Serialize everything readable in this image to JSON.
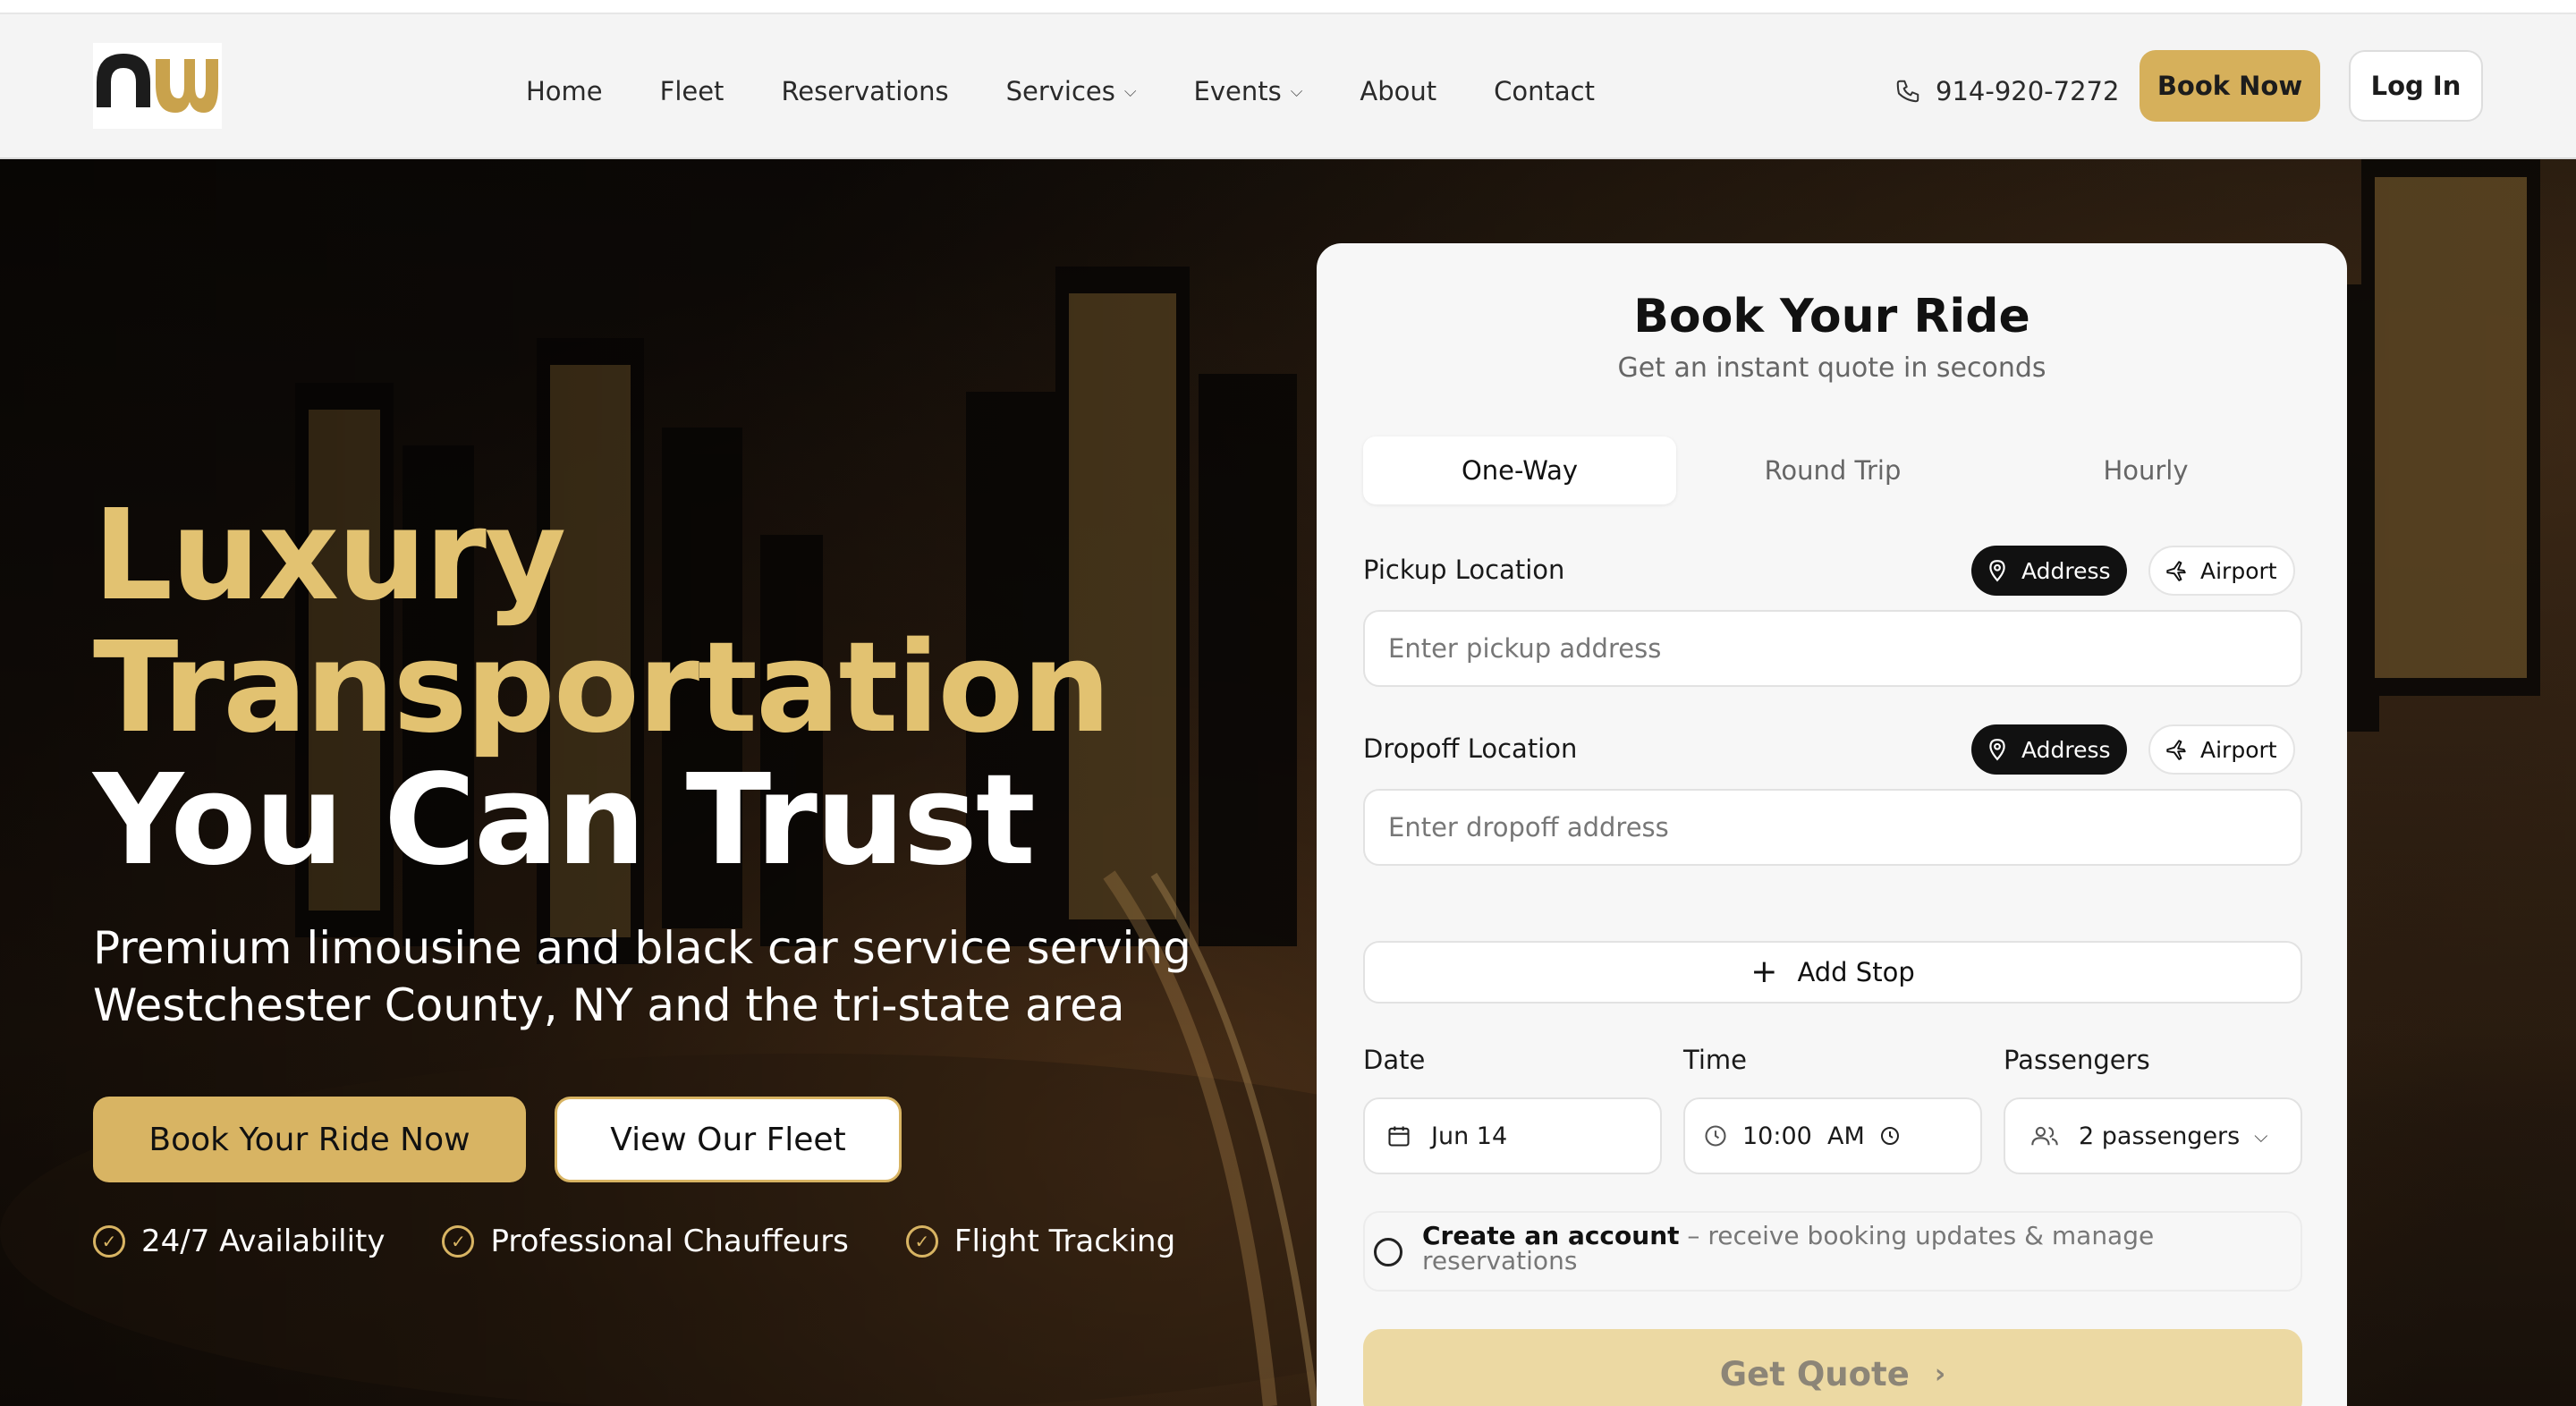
{
  "header": {
    "logo_text": "nw",
    "nav": [
      {
        "label": "Home",
        "dropdown": false
      },
      {
        "label": "Fleet",
        "dropdown": false
      },
      {
        "label": "Reservations",
        "dropdown": false
      },
      {
        "label": "Services",
        "dropdown": true
      },
      {
        "label": "Events",
        "dropdown": true
      },
      {
        "label": "About",
        "dropdown": false
      },
      {
        "label": "Contact",
        "dropdown": false
      }
    ],
    "phone": "914-920-7272",
    "book_label": "Book Now",
    "login_label": "Log In"
  },
  "hero": {
    "headline_line1": "Luxury",
    "headline_line2": "Transportation",
    "headline_line3": "You Can Trust",
    "subhead": "Premium limousine and black car service serving Westchester County, NY and the tri-state area",
    "primary_cta": "Book Your Ride Now",
    "secondary_cta": "View Our Fleet",
    "features": [
      "24/7 Availability",
      "Professional Chauffeurs",
      "Flight Tracking"
    ]
  },
  "booking": {
    "title": "Book Your Ride",
    "subtitle": "Get an instant quote in seconds",
    "tabs": [
      {
        "label": "One-Way",
        "active": true
      },
      {
        "label": "Round Trip",
        "active": false
      },
      {
        "label": "Hourly",
        "active": false
      }
    ],
    "pickup": {
      "label": "Pickup Location",
      "placeholder": "Enter pickup address",
      "toggle_address": "Address",
      "toggle_airport": "Airport"
    },
    "dropoff": {
      "label": "Dropoff Location",
      "placeholder": "Enter dropoff address",
      "toggle_address": "Address",
      "toggle_airport": "Airport"
    },
    "add_stop": "Add Stop",
    "date": {
      "label": "Date",
      "value": "Jun 14"
    },
    "time": {
      "label": "Time",
      "value": "10:00  AM"
    },
    "passengers": {
      "label": "Passengers",
      "value": "2 passengers"
    },
    "account": {
      "bold": "Create an account",
      "rest": " – receive booking updates & manage reservations"
    },
    "quote_label": "Get Quote"
  },
  "colors": {
    "accent_gold": "#d6b05b",
    "headline_gold": "#e2c271",
    "quote_disabled": "#ecd9a3"
  }
}
